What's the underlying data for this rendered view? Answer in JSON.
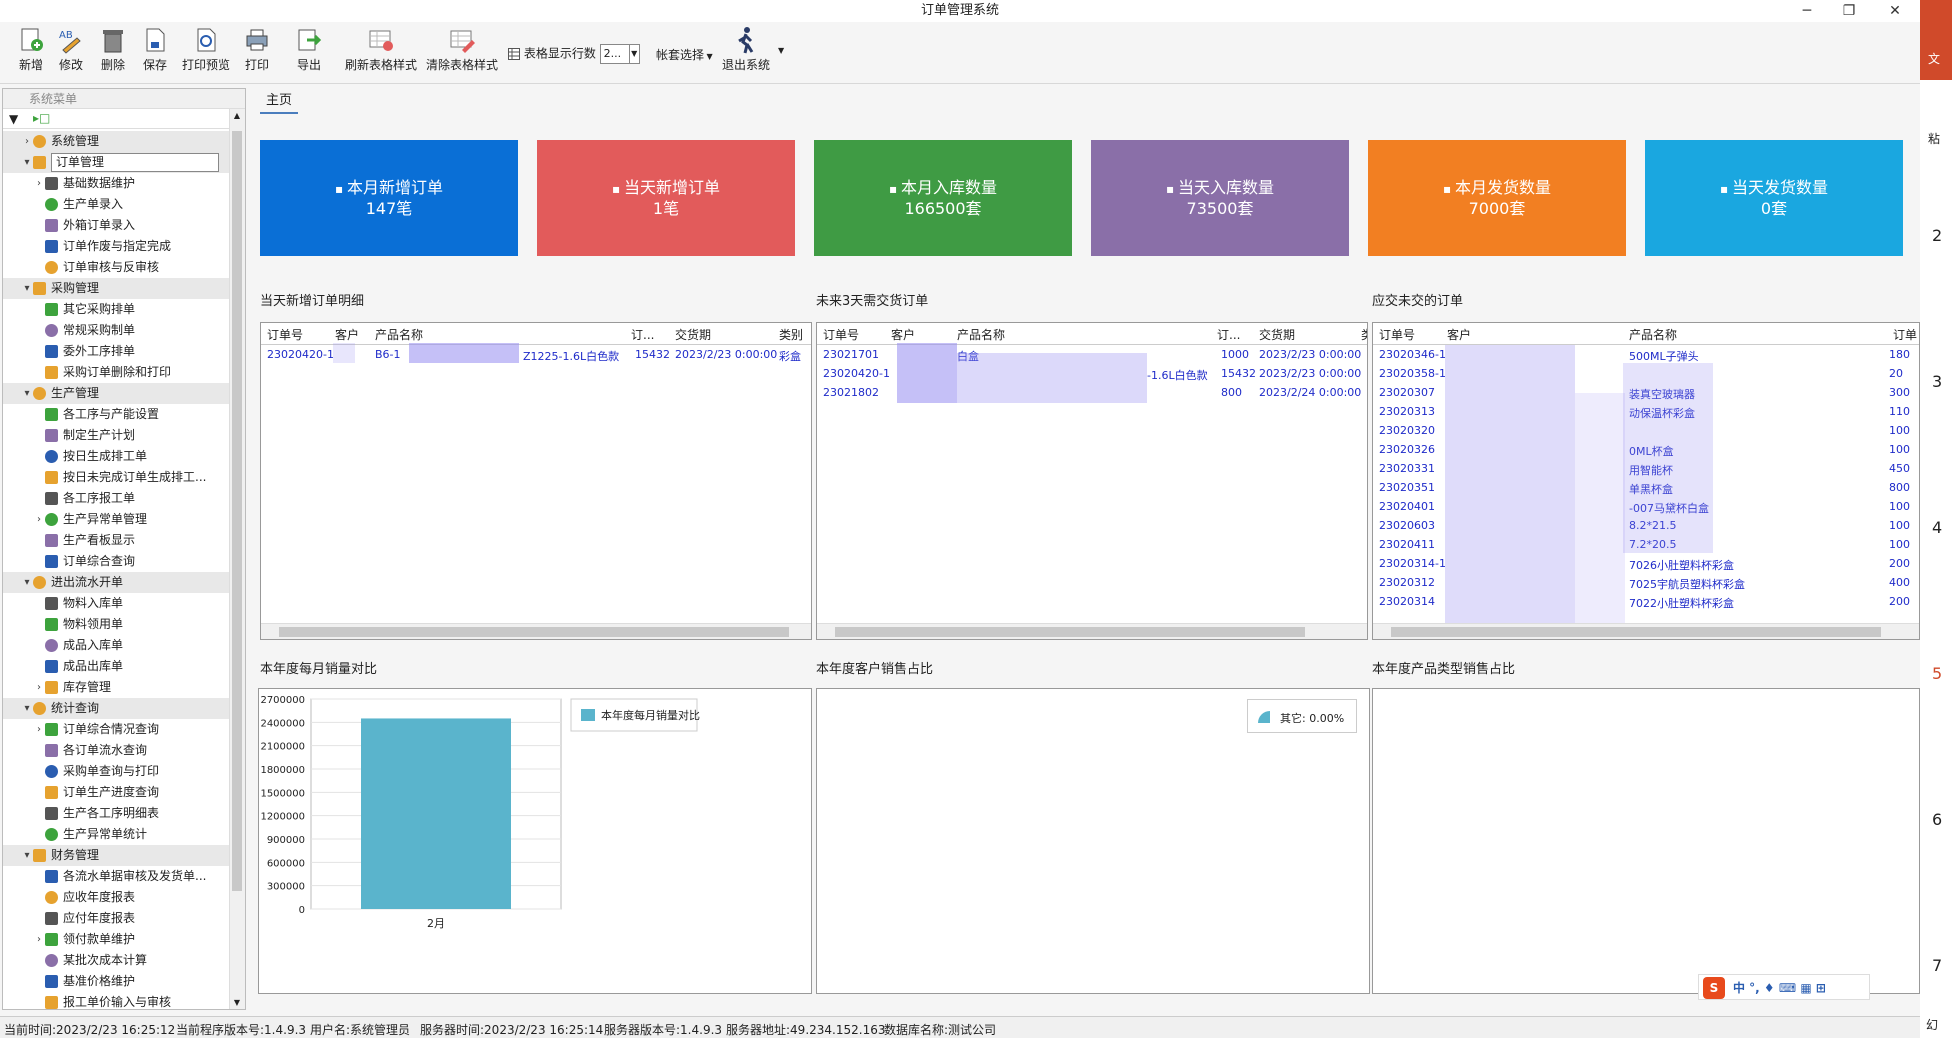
{
  "window": {
    "title": "订单管理系统"
  },
  "toolbar": {
    "new": "新增",
    "edit": "修改",
    "delete": "删除",
    "save": "保存",
    "preview": "打印预览",
    "print": "打印",
    "export": "导出",
    "refresh_style": "刷新表格样式",
    "clear_style": "清除表格样式",
    "rows_label": "表格显示行数",
    "rows_value": "2...",
    "account_select": "帐套选择",
    "exit": "退出系统"
  },
  "sidebar": {
    "header": "系统菜单",
    "items": [
      {
        "label": "系统管理",
        "level": 0,
        "expanded": false
      },
      {
        "label": "订单管理",
        "level": 0,
        "expanded": true,
        "selected": true
      },
      {
        "label": "基础数据维护",
        "level": 1,
        "expanded": false
      },
      {
        "label": "生产单录入",
        "level": 1
      },
      {
        "label": "外箱订单录入",
        "level": 1
      },
      {
        "label": "订单作废与指定完成",
        "level": 1
      },
      {
        "label": "订单审核与反审核",
        "level": 1
      },
      {
        "label": "采购管理",
        "level": 0,
        "expanded": true
      },
      {
        "label": "其它采购排单",
        "level": 1
      },
      {
        "label": "常规采购制单",
        "level": 1
      },
      {
        "label": "委外工序排单",
        "level": 1
      },
      {
        "label": "采购订单删除和打印",
        "level": 1
      },
      {
        "label": "生产管理",
        "level": 0,
        "expanded": true
      },
      {
        "label": "各工序与产能设置",
        "level": 1
      },
      {
        "label": "制定生产计划",
        "level": 1
      },
      {
        "label": "按日生成排工单",
        "level": 1
      },
      {
        "label": "按日未完成订单生成排工...",
        "level": 1
      },
      {
        "label": "各工序报工单",
        "level": 1
      },
      {
        "label": "生产异常单管理",
        "level": 1,
        "expanded": false
      },
      {
        "label": "生产看板显示",
        "level": 1
      },
      {
        "label": "订单综合查询",
        "level": 1
      },
      {
        "label": "进出流水开单",
        "level": 0,
        "expanded": true
      },
      {
        "label": "物料入库单",
        "level": 1
      },
      {
        "label": "物料领用单",
        "level": 1
      },
      {
        "label": "成品入库单",
        "level": 1
      },
      {
        "label": "成品出库单",
        "level": 1
      },
      {
        "label": "库存管理",
        "level": 1,
        "expanded": false
      },
      {
        "label": "统计查询",
        "level": 0,
        "expanded": true
      },
      {
        "label": "订单综合情况查询",
        "level": 1,
        "expanded": false
      },
      {
        "label": "各订单流水查询",
        "level": 1
      },
      {
        "label": "采购单查询与打印",
        "level": 1
      },
      {
        "label": "订单生产进度查询",
        "level": 1
      },
      {
        "label": "生产各工序明细表",
        "level": 1
      },
      {
        "label": "生产异常单统计",
        "level": 1
      },
      {
        "label": "财务管理",
        "level": 0,
        "expanded": true
      },
      {
        "label": "各流水单据审核及发货单...",
        "level": 1
      },
      {
        "label": "应收年度报表",
        "level": 1
      },
      {
        "label": "应付年度报表",
        "level": 1
      },
      {
        "label": "领付款单维护",
        "level": 1,
        "expanded": false
      },
      {
        "label": "某批次成本计算",
        "level": 1
      },
      {
        "label": "基准价格维护",
        "level": 1
      },
      {
        "label": "报工单价输入与审核",
        "level": 1
      }
    ]
  },
  "tab": {
    "home": "主页"
  },
  "cards": [
    {
      "title": "本月新增订单",
      "value": "147笔",
      "color": "#0a6fd6"
    },
    {
      "title": "当天新增订单",
      "value": "1笔",
      "color": "#e25b5b"
    },
    {
      "title": "本月入库数量",
      "value": "166500套",
      "color": "#3f9b44"
    },
    {
      "title": "当天入库数量",
      "value": "73500套",
      "color": "#8a6fa8"
    },
    {
      "title": "本月发货数量",
      "value": "7000套",
      "color": "#f27f22"
    },
    {
      "title": "当天发货数量",
      "value": "0套",
      "color": "#1aa7e0"
    }
  ],
  "sections": {
    "today_orders": "当天新增订单明细",
    "next3_orders": "未来3天需交货订单",
    "overdue_orders": "应交未交的订单",
    "monthly_chart": "本年度每月销量对比",
    "customer_chart": "本年度客户销售占比",
    "type_chart": "本年度产品类型销售占比"
  },
  "grid1": {
    "cols": [
      "订单号",
      "客户",
      "产品名称",
      "订...",
      "交货期",
      "类别"
    ],
    "rows": [
      [
        "23020420-1",
        "",
        "B6-1",
        "Z1225-1.6L白色款",
        "15432",
        "2023/2/23 0:00:00",
        "彩盒"
      ]
    ]
  },
  "grid2": {
    "cols": [
      "订单号",
      "客户",
      "产品名称",
      "订...",
      "交货期",
      "类"
    ],
    "rows": [
      [
        "23021701",
        "白盒",
        "",
        "1000",
        "2023/2/23 0:00:00"
      ],
      [
        "23020420-1",
        "",
        "-1.6L白色款",
        "15432",
        "2023/2/23 0:00:00"
      ],
      [
        "23021802",
        "",
        "",
        "800",
        "2023/2/24 0:00:00"
      ]
    ]
  },
  "grid3": {
    "cols": [
      "订单号",
      "客户",
      "产品名称",
      "订单"
    ],
    "rows": [
      [
        "23020346-1",
        "500ML子弹头",
        "180"
      ],
      [
        "23020358-1",
        "",
        "20"
      ],
      [
        "23020307",
        "装真空玻璃器",
        "300"
      ],
      [
        "23020313",
        "动保温杯彩盒",
        "110"
      ],
      [
        "23020320",
        "",
        "100"
      ],
      [
        "23020326",
        "0ML杯盒",
        "100"
      ],
      [
        "23020331",
        "用智能杯",
        "450"
      ],
      [
        "23020351",
        "单黑杯盒",
        "800"
      ],
      [
        "23020401",
        "-007马黛杯白盒",
        "100"
      ],
      [
        "23020603",
        "8.2*21.5",
        "100"
      ],
      [
        "23020411",
        "7.2*20.5",
        "100"
      ],
      [
        "23020314-1",
        "7026小肚塑料杯彩盒",
        "200"
      ],
      [
        "23020312",
        "7025宇航员塑料杯彩盒",
        "400"
      ],
      [
        "23020314",
        "7022小肚塑料杯彩盒",
        "200"
      ]
    ]
  },
  "chart_data": [
    {
      "type": "bar",
      "categories": [
        "2月"
      ],
      "values": [
        2450000
      ],
      "series": [
        {
          "name": "本年度每月销量对比",
          "values": [
            2450000
          ]
        }
      ],
      "title": "本年度每月销量对比",
      "ylim": [
        0,
        2700000
      ],
      "yticks": [
        "0",
        "300000",
        "600000",
        "900000",
        "1200000",
        "1500000",
        "1800000",
        "2100000",
        "2400000",
        "2700000"
      ],
      "legend": "top-right",
      "color": "#5ab4cc"
    },
    {
      "type": "pie",
      "title": "本年度客户销售占比",
      "legend_entries": [
        "其它: 0.00%"
      ],
      "legend": "top-right",
      "color": "#5ab4cc"
    }
  ],
  "statusbar": {
    "time": "当前时间:2023/2/23 16:25:12",
    "version": "当前程序版本号:1.4.9.3",
    "user": "用户名:系统管理员",
    "server_time": "服务器时间:2023/2/23 16:25:14",
    "server_version": "服务器版本号:1.4.9.3",
    "server_addr": "服务器地址:49.234.152.163",
    "db": "数据库名称:测试公司"
  },
  "rightstrip": {
    "chars": [
      "文",
      "粘",
      "2",
      "3",
      "4",
      "5",
      "6",
      "7",
      "幻"
    ]
  }
}
